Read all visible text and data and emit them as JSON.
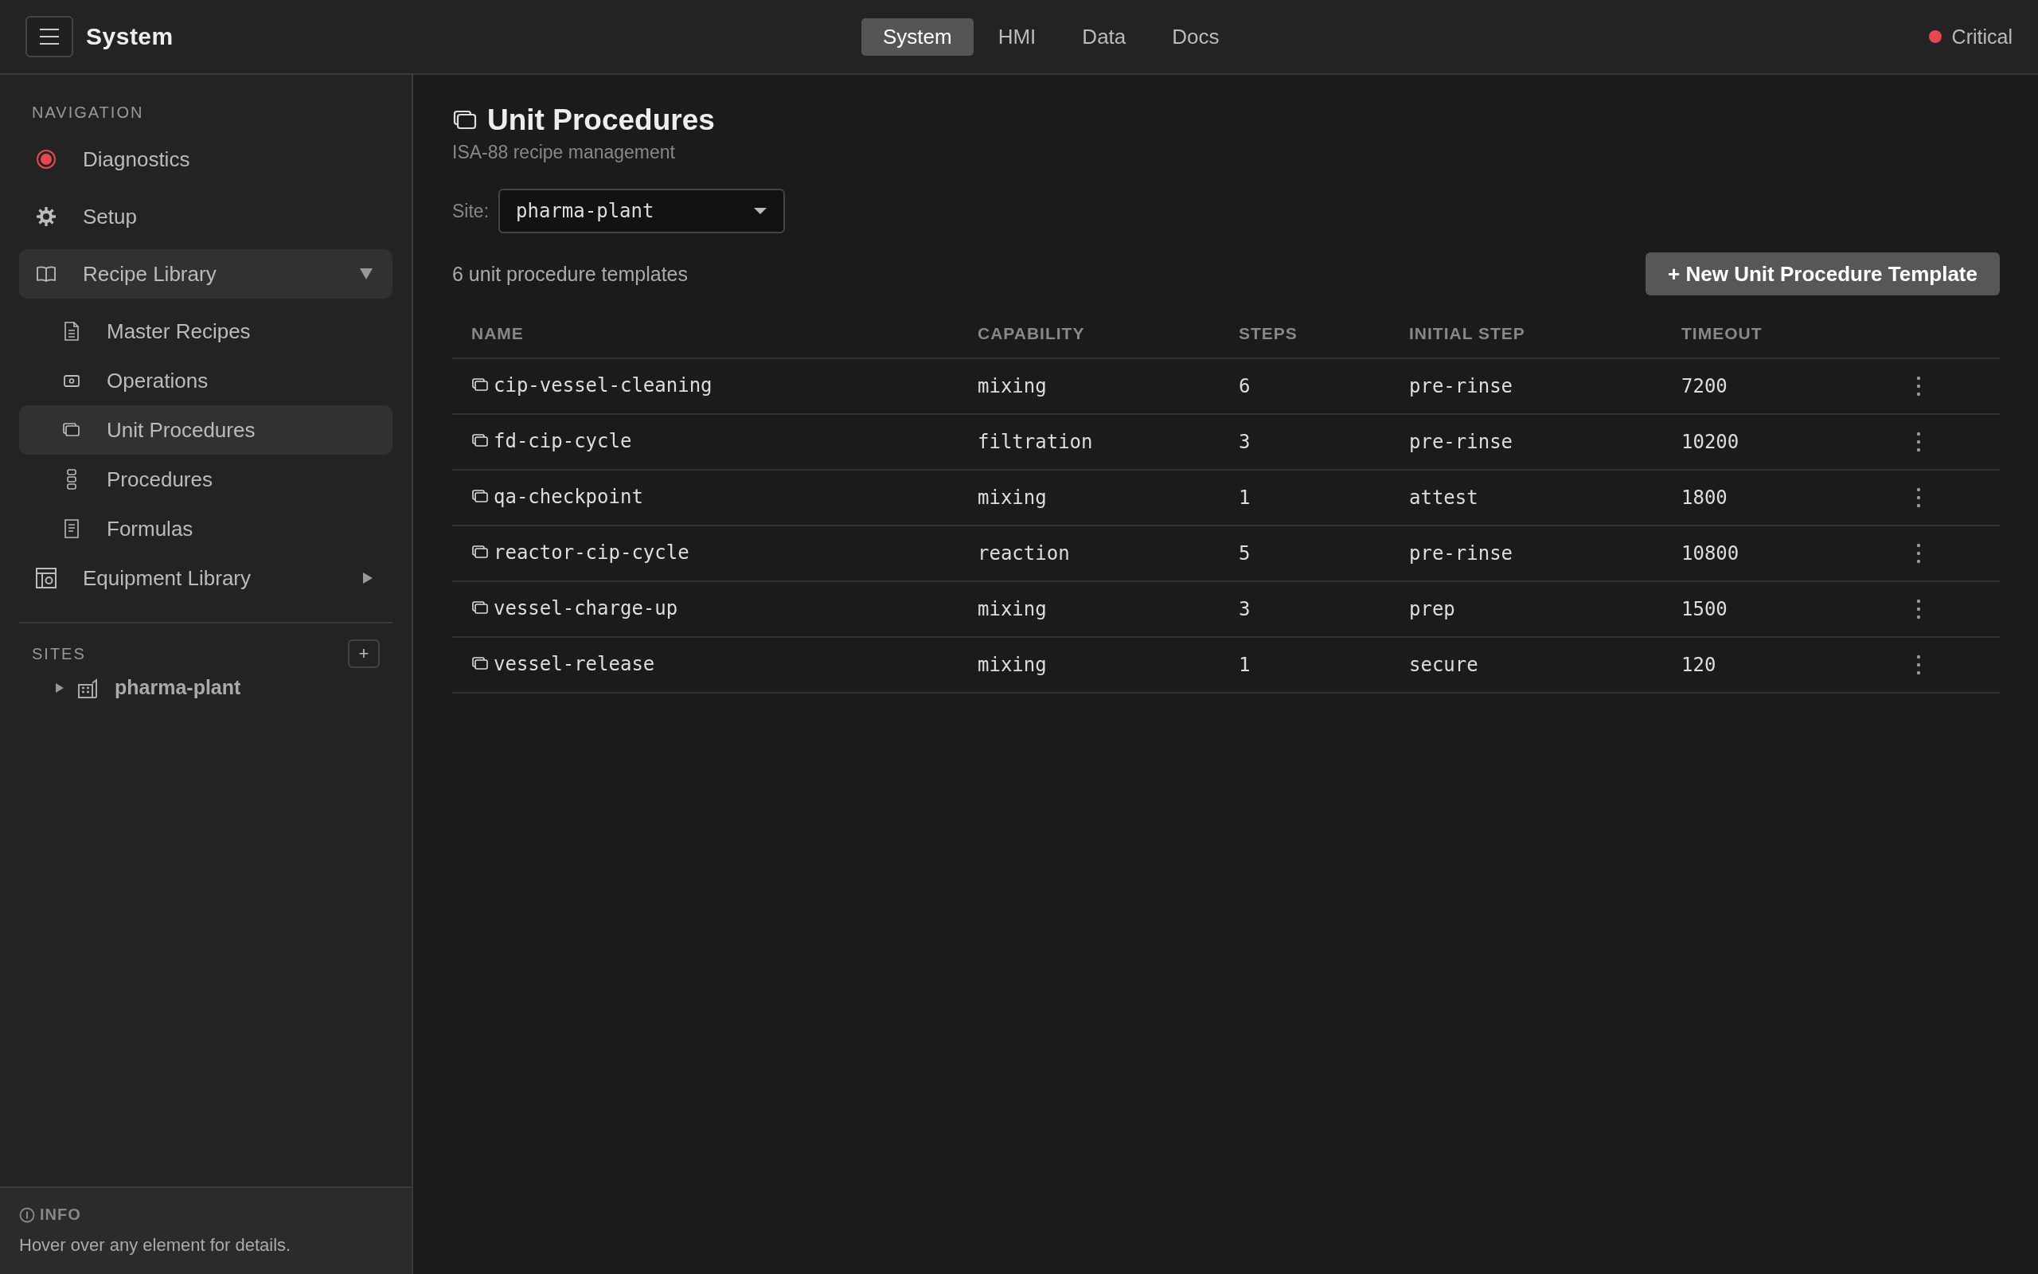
{
  "topbar": {
    "title": "System",
    "tabs": [
      {
        "label": "System",
        "selected": true
      },
      {
        "label": "HMI",
        "selected": false
      },
      {
        "label": "Data",
        "selected": false
      },
      {
        "label": "Docs",
        "selected": false
      }
    ],
    "status": {
      "label": "Critical"
    }
  },
  "sidebar": {
    "heading": "NAVIGATION",
    "items": [
      {
        "label": "Diagnostics",
        "selected": false
      },
      {
        "label": "Setup",
        "selected": false
      },
      {
        "label": "Recipe Library",
        "selected": true,
        "expanded": true,
        "children": [
          {
            "label": "Master Recipes",
            "selected": false
          },
          {
            "label": "Operations",
            "selected": false
          },
          {
            "label": "Unit Procedures",
            "selected": true
          },
          {
            "label": "Procedures",
            "selected": false
          },
          {
            "label": "Formulas",
            "selected": false
          }
        ]
      },
      {
        "label": "Equipment Library",
        "selected": false,
        "expanded": false
      }
    ],
    "sites": {
      "heading": "SITES",
      "add_label": "+",
      "items": [
        {
          "label": "pharma-plant",
          "expanded": false
        }
      ]
    },
    "info": {
      "heading": "INFO",
      "text": "Hover over any element for details."
    }
  },
  "page": {
    "title": "Unit Procedures",
    "subtitle": "ISA-88 recipe management",
    "site_filter": {
      "label": "Site:",
      "value": "pharma-plant"
    },
    "count": "6 unit procedure templates",
    "new_button": "+ New Unit Procedure Template",
    "table": {
      "columns": [
        "NAME",
        "CAPABILITY",
        "STEPS",
        "INITIAL STEP",
        "TIMEOUT"
      ],
      "rows": [
        {
          "name": "cip-vessel-cleaning",
          "capability": "mixing",
          "steps": "6",
          "initial_step": "pre-rinse",
          "timeout": "7200"
        },
        {
          "name": "fd-cip-cycle",
          "capability": "filtration",
          "steps": "3",
          "initial_step": "pre-rinse",
          "timeout": "10200"
        },
        {
          "name": "qa-checkpoint",
          "capability": "mixing",
          "steps": "1",
          "initial_step": "attest",
          "timeout": "1800"
        },
        {
          "name": "reactor-cip-cycle",
          "capability": "reaction",
          "steps": "5",
          "initial_step": "pre-rinse",
          "timeout": "10800"
        },
        {
          "name": "vessel-charge-up",
          "capability": "mixing",
          "steps": "3",
          "initial_step": "prep",
          "timeout": "1500"
        },
        {
          "name": "vessel-release",
          "capability": "mixing",
          "steps": "1",
          "initial_step": "secure",
          "timeout": "120"
        }
      ]
    }
  }
}
